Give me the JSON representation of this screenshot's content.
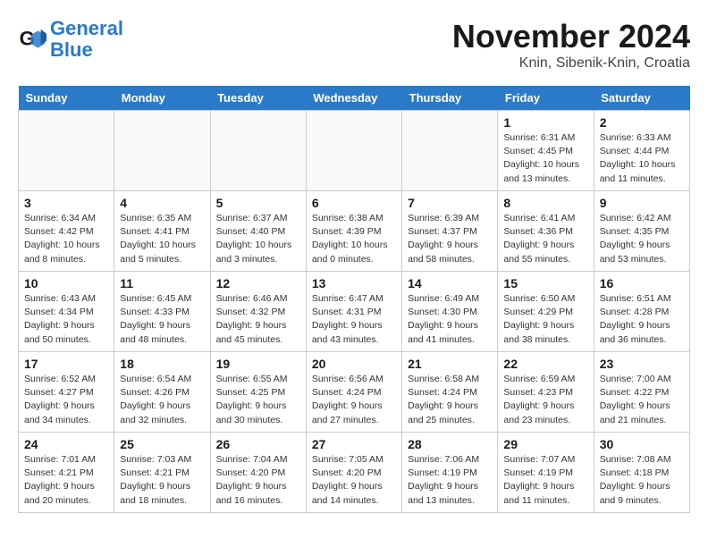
{
  "header": {
    "logo_line1": "General",
    "logo_line2": "Blue",
    "month_year": "November 2024",
    "location": "Knin, Sibenik-Knin, Croatia"
  },
  "weekdays": [
    "Sunday",
    "Monday",
    "Tuesday",
    "Wednesday",
    "Thursday",
    "Friday",
    "Saturday"
  ],
  "weeks": [
    [
      {
        "day": "",
        "info": ""
      },
      {
        "day": "",
        "info": ""
      },
      {
        "day": "",
        "info": ""
      },
      {
        "day": "",
        "info": ""
      },
      {
        "day": "",
        "info": ""
      },
      {
        "day": "1",
        "info": "Sunrise: 6:31 AM\nSunset: 4:45 PM\nDaylight: 10 hours and 13 minutes."
      },
      {
        "day": "2",
        "info": "Sunrise: 6:33 AM\nSunset: 4:44 PM\nDaylight: 10 hours and 11 minutes."
      }
    ],
    [
      {
        "day": "3",
        "info": "Sunrise: 6:34 AM\nSunset: 4:42 PM\nDaylight: 10 hours and 8 minutes."
      },
      {
        "day": "4",
        "info": "Sunrise: 6:35 AM\nSunset: 4:41 PM\nDaylight: 10 hours and 5 minutes."
      },
      {
        "day": "5",
        "info": "Sunrise: 6:37 AM\nSunset: 4:40 PM\nDaylight: 10 hours and 3 minutes."
      },
      {
        "day": "6",
        "info": "Sunrise: 6:38 AM\nSunset: 4:39 PM\nDaylight: 10 hours and 0 minutes."
      },
      {
        "day": "7",
        "info": "Sunrise: 6:39 AM\nSunset: 4:37 PM\nDaylight: 9 hours and 58 minutes."
      },
      {
        "day": "8",
        "info": "Sunrise: 6:41 AM\nSunset: 4:36 PM\nDaylight: 9 hours and 55 minutes."
      },
      {
        "day": "9",
        "info": "Sunrise: 6:42 AM\nSunset: 4:35 PM\nDaylight: 9 hours and 53 minutes."
      }
    ],
    [
      {
        "day": "10",
        "info": "Sunrise: 6:43 AM\nSunset: 4:34 PM\nDaylight: 9 hours and 50 minutes."
      },
      {
        "day": "11",
        "info": "Sunrise: 6:45 AM\nSunset: 4:33 PM\nDaylight: 9 hours and 48 minutes."
      },
      {
        "day": "12",
        "info": "Sunrise: 6:46 AM\nSunset: 4:32 PM\nDaylight: 9 hours and 45 minutes."
      },
      {
        "day": "13",
        "info": "Sunrise: 6:47 AM\nSunset: 4:31 PM\nDaylight: 9 hours and 43 minutes."
      },
      {
        "day": "14",
        "info": "Sunrise: 6:49 AM\nSunset: 4:30 PM\nDaylight: 9 hours and 41 minutes."
      },
      {
        "day": "15",
        "info": "Sunrise: 6:50 AM\nSunset: 4:29 PM\nDaylight: 9 hours and 38 minutes."
      },
      {
        "day": "16",
        "info": "Sunrise: 6:51 AM\nSunset: 4:28 PM\nDaylight: 9 hours and 36 minutes."
      }
    ],
    [
      {
        "day": "17",
        "info": "Sunrise: 6:52 AM\nSunset: 4:27 PM\nDaylight: 9 hours and 34 minutes."
      },
      {
        "day": "18",
        "info": "Sunrise: 6:54 AM\nSunset: 4:26 PM\nDaylight: 9 hours and 32 minutes."
      },
      {
        "day": "19",
        "info": "Sunrise: 6:55 AM\nSunset: 4:25 PM\nDaylight: 9 hours and 30 minutes."
      },
      {
        "day": "20",
        "info": "Sunrise: 6:56 AM\nSunset: 4:24 PM\nDaylight: 9 hours and 27 minutes."
      },
      {
        "day": "21",
        "info": "Sunrise: 6:58 AM\nSunset: 4:24 PM\nDaylight: 9 hours and 25 minutes."
      },
      {
        "day": "22",
        "info": "Sunrise: 6:59 AM\nSunset: 4:23 PM\nDaylight: 9 hours and 23 minutes."
      },
      {
        "day": "23",
        "info": "Sunrise: 7:00 AM\nSunset: 4:22 PM\nDaylight: 9 hours and 21 minutes."
      }
    ],
    [
      {
        "day": "24",
        "info": "Sunrise: 7:01 AM\nSunset: 4:21 PM\nDaylight: 9 hours and 20 minutes."
      },
      {
        "day": "25",
        "info": "Sunrise: 7:03 AM\nSunset: 4:21 PM\nDaylight: 9 hours and 18 minutes."
      },
      {
        "day": "26",
        "info": "Sunrise: 7:04 AM\nSunset: 4:20 PM\nDaylight: 9 hours and 16 minutes."
      },
      {
        "day": "27",
        "info": "Sunrise: 7:05 AM\nSunset: 4:20 PM\nDaylight: 9 hours and 14 minutes."
      },
      {
        "day": "28",
        "info": "Sunrise: 7:06 AM\nSunset: 4:19 PM\nDaylight: 9 hours and 13 minutes."
      },
      {
        "day": "29",
        "info": "Sunrise: 7:07 AM\nSunset: 4:19 PM\nDaylight: 9 hours and 11 minutes."
      },
      {
        "day": "30",
        "info": "Sunrise: 7:08 AM\nSunset: 4:18 PM\nDaylight: 9 hours and 9 minutes."
      }
    ]
  ]
}
